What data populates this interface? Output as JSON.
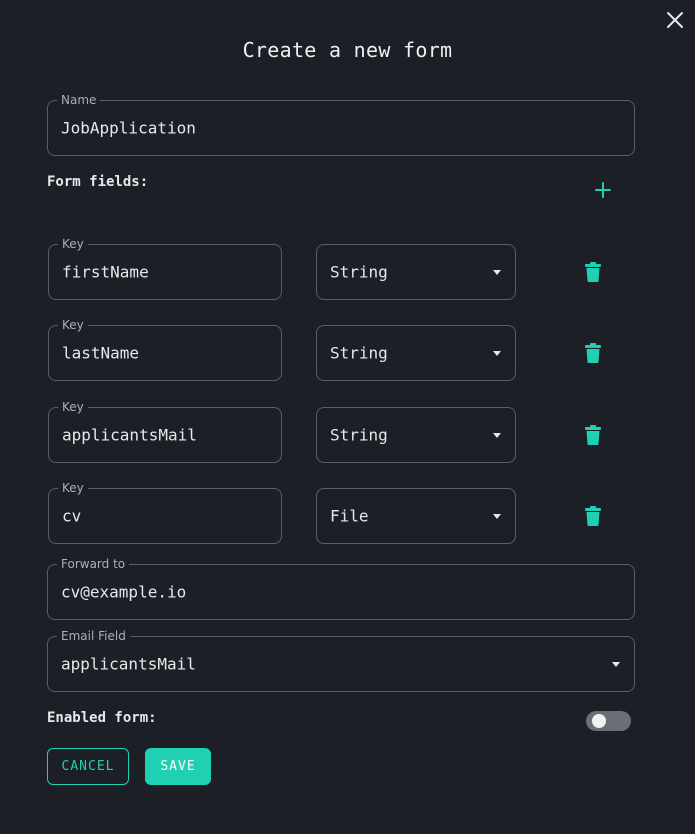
{
  "dialog": {
    "title": "Create a new form",
    "close_icon": "close-icon"
  },
  "name_field": {
    "label": "Name",
    "value": "JobApplication"
  },
  "form_fields": {
    "label": "Form fields:",
    "add_icon": "plus-icon",
    "accent_color": "#1fd1b2",
    "rows": [
      {
        "key_label": "Key",
        "key": "firstName",
        "type": "String"
      },
      {
        "key_label": "Key",
        "key": "lastName",
        "type": "String"
      },
      {
        "key_label": "Key",
        "key": "applicantsMail",
        "type": "String"
      },
      {
        "key_label": "Key",
        "key": "cv",
        "type": "File"
      }
    ],
    "delete_icon": "trash-icon"
  },
  "forward_to": {
    "label": "Forward to",
    "value": "cv@example.io"
  },
  "email_field": {
    "label": "Email Field",
    "value": "applicantsMail"
  },
  "enabled": {
    "label": "Enabled form:",
    "state": false
  },
  "actions": {
    "cancel_label": "CANCEL",
    "save_label": "SAVE"
  }
}
